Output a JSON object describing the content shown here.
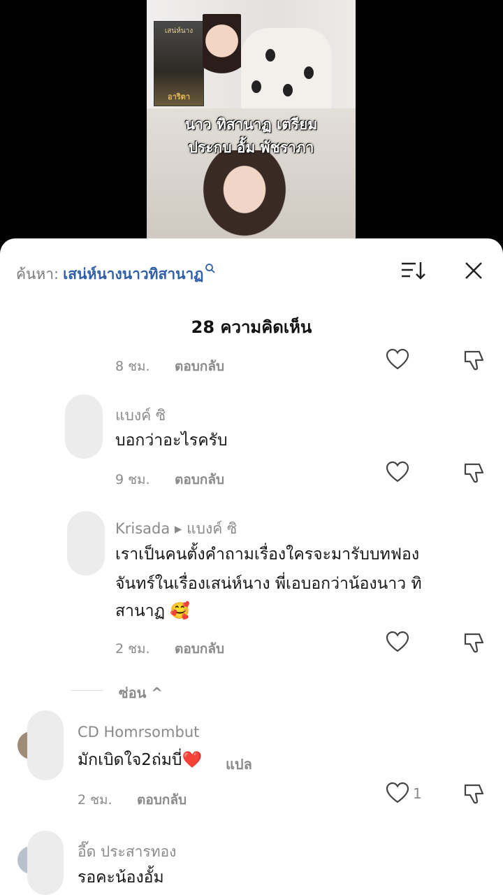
{
  "video": {
    "caption_line1": "นาว ทิสานาฏ เตรียม",
    "caption_line2": "ประกบ อั้ม พัชราภา",
    "poster_title": "เสน่ห์นาง",
    "poster_author": "อาริตา"
  },
  "header": {
    "search_prefix": "ค้นหา:",
    "search_term": "เสน่ห์นางนาวทิสานาฏ",
    "comment_count": "28 ความคิดเห็น"
  },
  "comments": [
    {
      "time": "8 ชม.",
      "reply": "ตอบกลับ"
    },
    {
      "name": "แบงค์ ซิ",
      "text": "บอกว่าอะไรครับ",
      "time": "9 ชม.",
      "reply": "ตอบกลับ"
    },
    {
      "name": "Krisada ▸ แบงค์ ซิ",
      "text": "เราเป็นคนตั้งคำถามเรื่องใครจะมารับบทฟอง",
      "text2": "จันทร์ในเรื่องเสน่ห์นาง พี่เอบอกว่าน้องนาว ทิ",
      "text3": "สานาฏ 🥰",
      "time": "2 ชม.",
      "reply": "ตอบกลับ"
    },
    {
      "name": "CD Homrsombut",
      "text": "มักเบิดใจ2ถ่มบี่❤️",
      "translate": "แปล",
      "time": "2 ชม.",
      "reply": "ตอบกลับ",
      "likes": "1"
    },
    {
      "name": "อี๊ด ประสารทอง",
      "text": "รอคะน้องอั้ม"
    }
  ],
  "hide_replies": "ซ่อน ^",
  "colors": {
    "accent_link": "#2e5fa8",
    "heart_red": "#e02020"
  }
}
